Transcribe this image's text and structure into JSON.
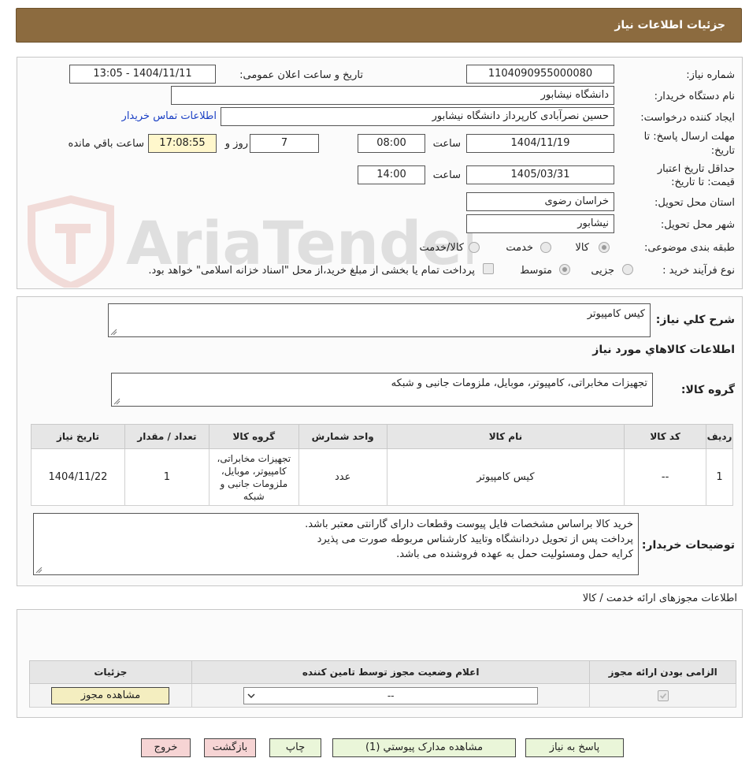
{
  "header": {
    "title": "جزئیات اطلاعات نیاز"
  },
  "watermark": {
    "text": "AriaTender.net"
  },
  "info": {
    "need_number_label": "شماره نیاز:",
    "need_number": "1104090955000080",
    "announce_label": "تاریخ و ساعت اعلان عمومی:",
    "announce_value": "1404/11/11 - 13:05",
    "buyer_org_label": "نام دستگاه خریدار:",
    "buyer_org": "دانشگاه نیشابور",
    "creator_label": "ایجاد کننده درخواست:",
    "creator": "حسین نصرآبادی کارپرداز دانشگاه نیشابور",
    "contact_link": "اطلاعات تماس خریدار",
    "deadline_label_1": "مهلت ارسال پاسخ: تا",
    "deadline_label_2": "تاریخ:",
    "deadline_date": "1404/11/19",
    "time_label": "ساعت",
    "deadline_time": "08:00",
    "days_value": "7",
    "days_label": "روز و",
    "remaining_time": "17:08:55",
    "remaining_label": "ساعت باقي مانده",
    "validity_label_1": "حداقل تاریخ اعتبار",
    "validity_label_2": "قیمت: تا تاریخ:",
    "validity_date": "1405/03/31",
    "validity_time_label": "ساعت",
    "validity_time": "14:00",
    "province_label": "استان محل تحویل:",
    "province": "خراسان رضوی",
    "city_label": "شهر محل تحویل:",
    "city": "نیشابور",
    "category_label": "طبقه بندی موضوعی:",
    "category_options": [
      "کالا",
      "خدمت",
      "کالا/خدمت"
    ],
    "category_selected": "کالا",
    "process_label": "نوع فرآیند خرید :",
    "process_options": [
      "جزیی",
      "متوسط"
    ],
    "process_selected": "متوسط",
    "payment_note": "پرداخت تمام یا بخشی از مبلغ خرید،از محل \"اسناد خزانه اسلامی\" خواهد بود."
  },
  "description": {
    "summary_label": "شرح کلي نياز:",
    "summary_value": "کیس کامپیوتر",
    "goods_info_title": "اطلاعات کالاهاي مورد نياز",
    "goods_group_label": "گروه کالا:",
    "goods_group_value": "تجهیزات مخابراتی، کامپیوتر، موبایل، ملزومات جانبی و شبکه"
  },
  "items_table": {
    "headers": [
      "ردیف",
      "کد کالا",
      "نام کالا",
      "واحد شمارش",
      "گروه کالا",
      "تعداد / مقدار",
      "تاریخ نیاز"
    ],
    "rows": [
      {
        "row": "1",
        "code": "--",
        "name": "کیس کامپیوتر",
        "unit": "عدد",
        "group": "تجهیزات مخابراتی، کامپیوتر، موبایل، ملزومات جانبی و شبکه",
        "qty": "1",
        "date": "1404/11/22"
      }
    ]
  },
  "buyer_notes": {
    "label": "توضیحات خریدار:",
    "lines": [
      "خرید کالا براساس مشخصات فایل پیوست وقطعات دارای گارانتی معتبر باشد.",
      "پرداخت پس از تحویل دردانشگاه وتایید کارشناس مربوطه صورت می پذیرد",
      "کرایه حمل ومسئولیت حمل به عهده فروشنده می باشد."
    ]
  },
  "permits": {
    "title": "اطلاعات مجوزهای ارائه خدمت / کالا",
    "headers": [
      "الزامی بودن ارائه مجوز",
      "اعلام وضعیت مجوز توسط تامین کننده",
      "جزئیات"
    ],
    "select_value": "--",
    "view_button": "مشاهده مجوز"
  },
  "actions": {
    "reply": "پاسخ به نیاز",
    "attachments": "مشاهده مدارک پیوستي (1)",
    "print": "چاپ",
    "back": "بازگشت",
    "exit": "خروج"
  }
}
